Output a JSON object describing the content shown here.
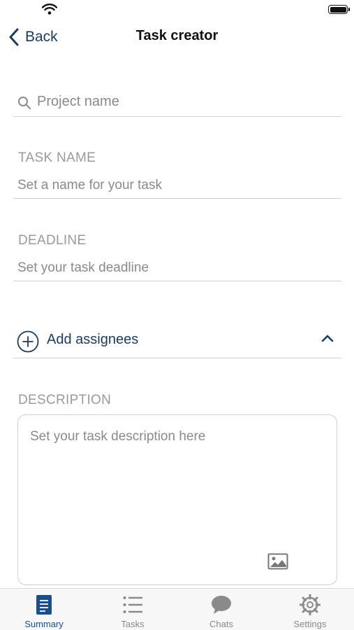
{
  "status_bar": {
    "wifi_icon": "wifi-icon",
    "battery_icon": "battery-icon"
  },
  "nav": {
    "back_label": "Back",
    "title": "Task creator"
  },
  "project_search": {
    "placeholder": "Project name",
    "value": ""
  },
  "task_name": {
    "label": "TASK NAME",
    "placeholder": "Set a name for your task",
    "value": ""
  },
  "deadline": {
    "label": "DEADLINE",
    "placeholder": "Set your task deadline",
    "value": ""
  },
  "assignees": {
    "label": "Add assignees",
    "expanded": true
  },
  "description": {
    "label": "DESCRIPTION",
    "placeholder": "Set your task description here",
    "value": ""
  },
  "tabs": [
    {
      "label": "Summary",
      "icon": "document-icon",
      "active": true
    },
    {
      "label": "Tasks",
      "icon": "list-icon",
      "active": false
    },
    {
      "label": "Chats",
      "icon": "chat-bubble-icon",
      "active": false
    },
    {
      "label": "Settings",
      "icon": "gear-icon",
      "active": false
    }
  ],
  "colors": {
    "accent": "#1b4f8a",
    "inactive": "#8a8a8a",
    "label": "#9a9a9a",
    "divider": "#d0d0d0"
  }
}
